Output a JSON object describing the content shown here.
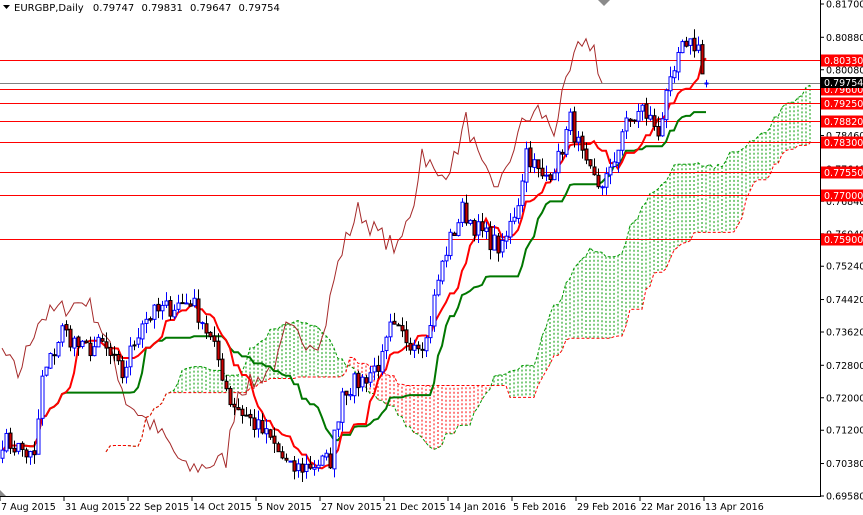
{
  "chart_data": {
    "type": "candlestick",
    "symbol": "EURGBP,Daily",
    "header_ohlc": {
      "open": "0.79747",
      "high": "0.79831",
      "low": "0.79647",
      "close": "0.79754"
    },
    "last_ohlc": [
      0.79747,
      0.79831,
      0.79647,
      0.79754
    ],
    "current_price_label": "0.79754",
    "ylim": [
      0.6958,
      0.817
    ],
    "y_ticks": [
      "0.81700",
      "0.80880",
      "0.80080",
      "0.79260",
      "0.78460",
      "0.77640",
      "0.76840",
      "0.76040",
      "0.75240",
      "0.74420",
      "0.73620",
      "0.72800",
      "0.72000",
      "0.71200",
      "0.70380",
      "0.69580"
    ],
    "x_ticks": [
      {
        "bar": 0,
        "label": "7 Aug 2015"
      },
      {
        "bar": 16,
        "label": "31 Aug 2015"
      },
      {
        "bar": 32,
        "label": "22 Sep 2015"
      },
      {
        "bar": 48,
        "label": "14 Oct 2015"
      },
      {
        "bar": 64,
        "label": "5 Nov 2015"
      },
      {
        "bar": 80,
        "label": "27 Nov 2015"
      },
      {
        "bar": 96,
        "label": "21 Dec 2015"
      },
      {
        "bar": 112,
        "label": "14 Jan 2016"
      },
      {
        "bar": 128,
        "label": "5 Feb 2016"
      },
      {
        "bar": 144,
        "label": "29 Feb 2016"
      },
      {
        "bar": 160,
        "label": "22 Mar 2016"
      },
      {
        "bar": 176,
        "label": "13 Apr 2016"
      }
    ],
    "bar_count": 177,
    "close_path": [
      [
        0,
        0.7096
      ],
      [
        5,
        0.7071
      ],
      [
        8,
        0.7047
      ],
      [
        10,
        0.7244
      ],
      [
        15,
        0.7367
      ],
      [
        20,
        0.7318
      ],
      [
        25,
        0.733
      ],
      [
        30,
        0.7256
      ],
      [
        35,
        0.7392
      ],
      [
        40,
        0.7416
      ],
      [
        47,
        0.7441
      ],
      [
        50,
        0.7392
      ],
      [
        54,
        0.7293
      ],
      [
        57,
        0.7194
      ],
      [
        62,
        0.7145
      ],
      [
        67,
        0.7096
      ],
      [
        72,
        0.7022
      ],
      [
        77,
        0.7034
      ],
      [
        82,
        0.7047
      ],
      [
        85,
        0.7219
      ],
      [
        90,
        0.7244
      ],
      [
        95,
        0.7293
      ],
      [
        97,
        0.7367
      ],
      [
        102,
        0.7342
      ],
      [
        106,
        0.7342
      ],
      [
        109,
        0.749
      ],
      [
        111,
        0.7564
      ],
      [
        115,
        0.7662
      ],
      [
        119,
        0.7613
      ],
      [
        122,
        0.7589
      ],
      [
        125,
        0.7564
      ],
      [
        129,
        0.7687
      ],
      [
        131,
        0.781
      ],
      [
        135,
        0.7736
      ],
      [
        139,
        0.7786
      ],
      [
        142,
        0.7884
      ],
      [
        146,
        0.7761
      ],
      [
        149,
        0.7724
      ],
      [
        152,
        0.7749
      ],
      [
        155,
        0.786
      ],
      [
        160,
        0.7909
      ],
      [
        164,
        0.786
      ],
      [
        166,
        0.7933
      ],
      [
        169,
        0.8032
      ],
      [
        171,
        0.8081
      ],
      [
        174,
        0.8069
      ],
      [
        175,
        0.7995
      ],
      [
        176,
        0.79754
      ]
    ],
    "levels": [
      {
        "price": 0.8033,
        "label": "0.80330"
      },
      {
        "price": 0.796,
        "label": "0.79600"
      },
      {
        "price": 0.7925,
        "label": "0.79250"
      },
      {
        "price": 0.7882,
        "label": "0.78820"
      },
      {
        "price": 0.783,
        "label": "0.78300"
      },
      {
        "price": 0.7755,
        "label": "0.77550"
      },
      {
        "price": 0.77,
        "label": "0.77000"
      },
      {
        "price": 0.759,
        "label": "0.75900"
      }
    ],
    "indicator": {
      "name": "Ichimoku",
      "tenkan": 9,
      "kijun": 26,
      "senkou_b": 52,
      "shift": 26
    },
    "colors": {
      "bull": "#0000ff",
      "bear": "#cc0000",
      "tenkan": "#ff0000",
      "kijun": "#007700",
      "chikou": "#a52a2a",
      "cloud_up": "#009900",
      "cloud_down": "#ff0000",
      "level": "#ff0000",
      "current": "#808080"
    }
  }
}
